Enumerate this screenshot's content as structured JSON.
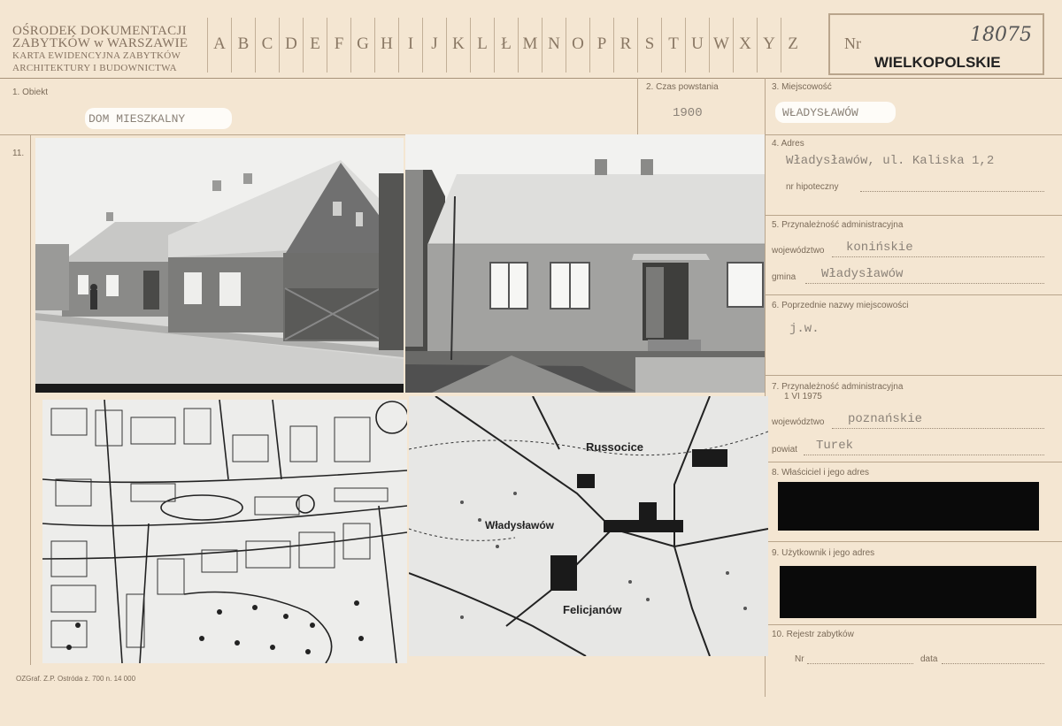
{
  "header": {
    "institution_line1": "OŚRODEK DOKUMENTACJI",
    "institution_line2": "ZABYTKÓW w WARSZAWIE",
    "institution_line3": "KARTA EWIDENCYJNA ZABYTKÓW",
    "institution_line4": "ARCHITEKTURY I BUDOWNICTWA",
    "letters": [
      "A",
      "B",
      "C",
      "D",
      "E",
      "F",
      "G",
      "H",
      "I",
      "J",
      "K",
      "L",
      "Ł",
      "M",
      "N",
      "O",
      "P",
      "R",
      "S",
      "T",
      "U",
      "W",
      "X",
      "Y",
      "Z"
    ],
    "nr_label": "Nr",
    "nr_value": "18075",
    "region": "WIELKOPOLSKIE"
  },
  "fields": {
    "obiekt_label": "1. Obiekt",
    "obiekt_value": "DOM MIESZKALNY",
    "czas_label": "2. Czas powstania",
    "czas_value": "1900",
    "miejscowosc_label": "3. Miejscowość",
    "miejscowosc_value": "WŁADYSŁAWÓW",
    "photos_label": "11.",
    "adres_label": "4. Adres",
    "adres_value": "Władysławów, ul. Kaliska 1,2",
    "hipoteczny_label": "nr hipoteczny",
    "przynaleznosc_label": "5. Przynależność administracyjna",
    "woj_label": "województwo",
    "woj_value": "konińskie",
    "gmina_label": "gmina",
    "gmina_value": "Władysławów",
    "poprzednie_label": "6. Poprzednie nazwy miejscowości",
    "poprzednie_value": "j.w.",
    "przyn1975_label": "7. Przynależność administracyjna",
    "przyn1975_date": "1 VI 1975",
    "woj2_label": "województwo",
    "woj2_value": "poznańskie",
    "powiat_label": "powiat",
    "powiat_value": "Turek",
    "wlasciciel_label": "8. Właściciel i jego adres",
    "uzytkownik_label": "9. Użytkownik i jego adres",
    "rejestr_label": "10. Rejestr zabytków",
    "rejestr_nr_label": "Nr",
    "rejestr_data_label": "data"
  },
  "map2": {
    "label_russocice": "Russocice",
    "label_wladyslawow": "Władysławów",
    "label_felicjanow": "Felicjanów"
  },
  "footer": {
    "print_info": "OZGraf. Z.P. Ostróda z. 700 n. 14 000"
  }
}
